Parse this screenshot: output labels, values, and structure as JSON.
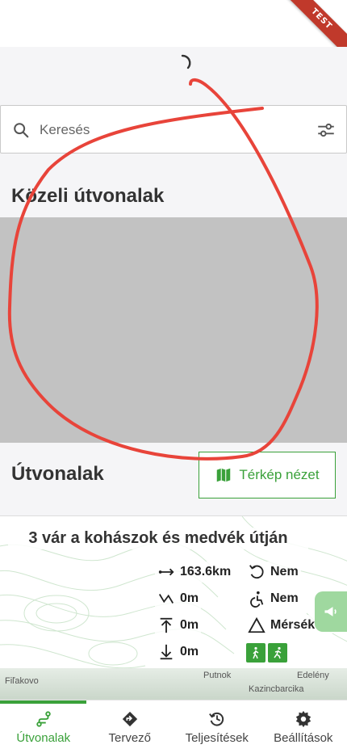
{
  "badge": {
    "test_label": "TEST"
  },
  "search": {
    "placeholder": "Keresés",
    "icon": "search-icon",
    "filter_icon": "tune-icon"
  },
  "nearby": {
    "title": "Közeli útvonalak"
  },
  "routes": {
    "title": "Útvonalak",
    "map_view_label": "Térkép nézet",
    "map_view_icon": "map-icon"
  },
  "route_card": {
    "title": "3 vár a kohászok és medvék útján",
    "distance": "163.6km",
    "elevation_change": "0m",
    "ascent": "0m",
    "descent": "0m",
    "round_trip": "Nem",
    "accessible": "Nem",
    "difficulty": "Mérsékelt",
    "activity_icons": [
      "hiking-icon",
      "running-icon"
    ],
    "places": [
      "Putnok",
      "Edelény",
      "Fiľakovo",
      "Kazincbarcika"
    ]
  },
  "nav": {
    "items": [
      {
        "label": "Útvonalak",
        "icon": "route-icon"
      },
      {
        "label": "Tervező",
        "icon": "directions-icon"
      },
      {
        "label": "Teljesítések",
        "icon": "history-icon"
      },
      {
        "label": "Beállítások",
        "icon": "settings-icon"
      }
    ],
    "active_index": 0
  },
  "colors": {
    "accent": "#3aa13a",
    "annotation": "#e8443a",
    "map_placeholder": "#c2c2c2",
    "ribbon": "#c0392b"
  }
}
